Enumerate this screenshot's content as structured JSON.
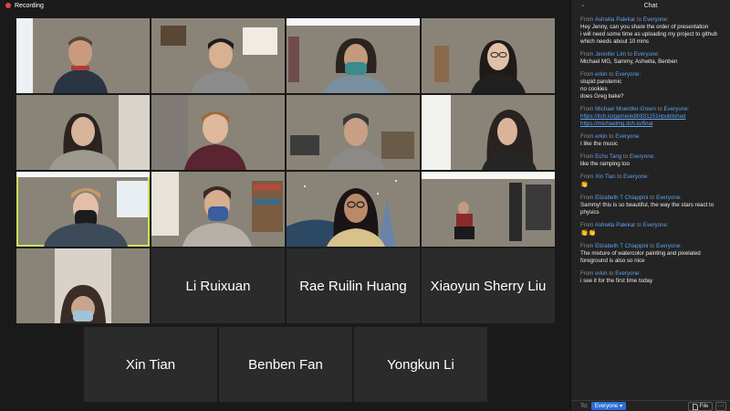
{
  "recording": {
    "label": "Recording"
  },
  "participants": {
    "row4": [
      "Li Ruixuan",
      "Rae Ruilin Huang",
      "Xiaoyun Sherry Liu"
    ],
    "row5": [
      "Xin Tian",
      "Benben Fan",
      "Yongkun Li"
    ]
  },
  "chat": {
    "title": "Chat",
    "from_word": "From",
    "to_word": "to",
    "messages": [
      {
        "from": "Ashwita Palekar",
        "to": "Everyone",
        "lines": [
          "Hey Jenny, can you share the order of presentation",
          "i will need some time as uploading my project to github",
          "which needs about 10 mins"
        ]
      },
      {
        "from": "Jennifer Lim",
        "to": "Everyone",
        "lines": [
          "Michael MG, Sammy, Ashwita, Benben"
        ]
      },
      {
        "from": "erkin",
        "to": "Everyone",
        "lines": [
          "stupid pandemic",
          "no cookies",
          "does Greg bake?"
        ]
      },
      {
        "from": "Michael Moerdler-Green",
        "to": "Everyone",
        "links": [
          "https://itch.io/game/edit/831151#published",
          "https://michaelmg.itch.io/final"
        ]
      },
      {
        "from": "erkin",
        "to": "Everyone",
        "lines": [
          "I like the music"
        ]
      },
      {
        "from": "Echo Tang",
        "to": "Everyone",
        "lines": [
          "like the ramping too"
        ]
      },
      {
        "from": "Xin Tian",
        "to": "Everyone",
        "lines": [
          "👏"
        ]
      },
      {
        "from": "Elizabeth T Chiappini",
        "to": "Everyone",
        "lines": [
          "Sammy! this is so beautiful, the way the stars react to",
          "physics"
        ]
      },
      {
        "from": "Ashwita Palekar",
        "to": "Everyone",
        "lines": [
          "👏👏"
        ]
      },
      {
        "from": "Elizabeth T Chiappini",
        "to": "Everyone",
        "lines": [
          "The mixture of watercolor painting and pixelated",
          "foreground is also so nice"
        ]
      },
      {
        "from": "erkin",
        "to": "Everyone",
        "lines": [
          "i see it for the first time today"
        ]
      }
    ],
    "footer": {
      "to_label": "To:",
      "recipient": "Everyone",
      "file_label": "File",
      "more_label": "···"
    }
  }
}
